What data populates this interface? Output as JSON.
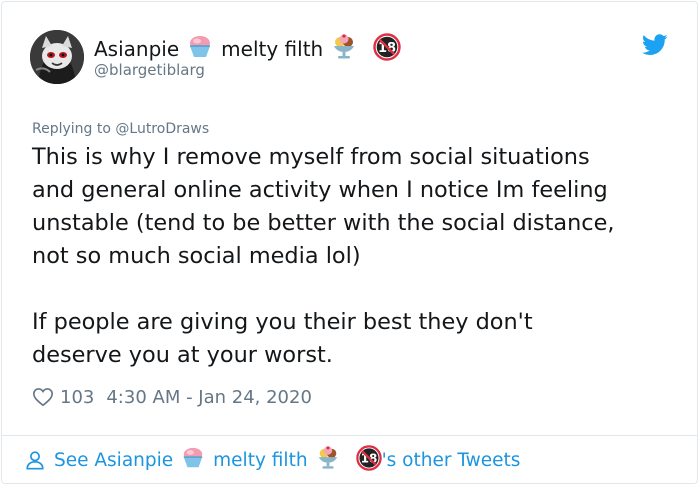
{
  "author": {
    "name_part1": "Asianpie",
    "name_part2": "melty filth",
    "handle": "@blargetiblarg",
    "name_icons": [
      "shaved-ice-icon",
      "ice-cream-sundae-icon",
      "no-one-under-18-icon"
    ]
  },
  "brand_icon": "twitter-bird-icon",
  "reply": {
    "prefix": "Replying to",
    "target": "@LutroDraws"
  },
  "tweet": {
    "text": "This is why I remove myself from social situations\nand general online activity when I notice Im feeling\nunstable (tend to be better with the social distance,\nnot so much social media lol)\n\nIf people are giving you their best they don't\ndeserve you at your worst."
  },
  "stats": {
    "likes": "103",
    "timestamp": "4:30 AM - Jan 24, 2020"
  },
  "footer": {
    "prefix": "See Asianpie",
    "middle": "melty filth",
    "suffix": "'s other Tweets"
  },
  "colors": {
    "link_blue": "#1b95e0",
    "muted_gray": "#657786",
    "text": "#14171a",
    "border": "#e1e8ed"
  }
}
